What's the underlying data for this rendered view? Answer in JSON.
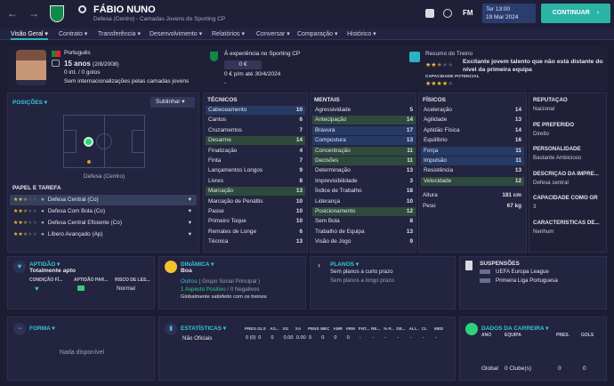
{
  "header": {
    "player_name": "FÁBIO NUNO",
    "subtitle": "Defesa (Centro) - Camadas Jovens do Sporting CP",
    "fm_label": "FM",
    "date_day": "Ter 13:00",
    "date_full": "19 Mar 2024",
    "continue_label": "CONTINUAR"
  },
  "nav": {
    "tabs": [
      "Visão Geral",
      "Contrato",
      "Transferência",
      "Desenvolvimento",
      "Relatórios",
      "Conversar",
      "Comparação",
      "Histórico"
    ]
  },
  "profile": {
    "nationality": "Português",
    "age": "15 anos",
    "birth": "(2/8/2008)",
    "intl": "0 int. / 0 golos",
    "no_youth_caps": "Sem internacionalizações pelas camadas jovens"
  },
  "club": {
    "trial_text": "À experiência no Sporting CP",
    "value": "0 €",
    "wage": "0 € p/m até 30/4/2024",
    "dash": "-"
  },
  "training": {
    "title": "Resumo do Treino",
    "text": "Excitante jovem talento que não está distante do nível da primeira equipa",
    "potential_label": "CAPACIDADE POTENCIAL",
    "current_stars": 2.5,
    "potential_stars": 4
  },
  "positions": {
    "title": "POSIÇÕES",
    "dropdown": "Sublinhar",
    "position_label": "Defesa (Centro)"
  },
  "roles": {
    "title": "PAPEL E TAREFA",
    "items": [
      {
        "name": "Defesa Central (Co)",
        "stars": 2.5
      },
      {
        "name": "Defesa Com Bola (Co)",
        "stars": 2.5
      },
      {
        "name": "Defesa Central Eficiente (Co)",
        "stars": 2.5
      },
      {
        "name": "Líbero Avançado (Ap)",
        "stars": 2.5
      }
    ]
  },
  "technical": {
    "title": "TÉCNICOS",
    "items": [
      {
        "name": "Cabeceamento",
        "value": "10",
        "hl": "blue"
      },
      {
        "name": "Cantos",
        "value": "6",
        "hl": ""
      },
      {
        "name": "Cruzamentos",
        "value": "7",
        "hl": ""
      },
      {
        "name": "Desarme",
        "value": "14",
        "hl": "green"
      },
      {
        "name": "Finalização",
        "value": "4",
        "hl": ""
      },
      {
        "name": "Finta",
        "value": "7",
        "hl": ""
      },
      {
        "name": "Lançamentos Longos",
        "value": "9",
        "hl": ""
      },
      {
        "name": "Livres",
        "value": "8",
        "hl": ""
      },
      {
        "name": "Marcação",
        "value": "13",
        "hl": "green"
      },
      {
        "name": "Marcação de Penáltis",
        "value": "10",
        "hl": ""
      },
      {
        "name": "Passe",
        "value": "10",
        "hl": ""
      },
      {
        "name": "Primeiro Toque",
        "value": "10",
        "hl": ""
      },
      {
        "name": "Remates de Longe",
        "value": "6",
        "hl": ""
      },
      {
        "name": "Técnica",
        "value": "13",
        "hl": ""
      }
    ]
  },
  "mental": {
    "title": "MENTAIS",
    "items": [
      {
        "name": "Agressividade",
        "value": "5",
        "hl": ""
      },
      {
        "name": "Antecipação",
        "value": "14",
        "hl": "green"
      },
      {
        "name": "Bravura",
        "value": "17",
        "hl": "blue"
      },
      {
        "name": "Compostura",
        "value": "13",
        "hl": "blue"
      },
      {
        "name": "Concentração",
        "value": "11",
        "hl": "green"
      },
      {
        "name": "Decisões",
        "value": "11",
        "hl": "green"
      },
      {
        "name": "Determinação",
        "value": "13",
        "hl": ""
      },
      {
        "name": "Imprevisibilidade",
        "value": "3",
        "hl": ""
      },
      {
        "name": "Índice de Trabalho",
        "value": "18",
        "hl": ""
      },
      {
        "name": "Liderança",
        "value": "10",
        "hl": ""
      },
      {
        "name": "Posicionamento",
        "value": "12",
        "hl": "green"
      },
      {
        "name": "Sem Bola",
        "value": "8",
        "hl": ""
      },
      {
        "name": "Trabalho de Equipa",
        "value": "13",
        "hl": ""
      },
      {
        "name": "Visão de Jogo",
        "value": "9",
        "hl": ""
      }
    ]
  },
  "physical": {
    "title": "FÍSICOS",
    "items": [
      {
        "name": "Aceleração",
        "value": "14",
        "hl": ""
      },
      {
        "name": "Agilidade",
        "value": "13",
        "hl": ""
      },
      {
        "name": "Aptidão Física",
        "value": "14",
        "hl": ""
      },
      {
        "name": "Equilíbrio",
        "value": "16",
        "hl": ""
      },
      {
        "name": "Força",
        "value": "11",
        "hl": "blue"
      },
      {
        "name": "Impulsão",
        "value": "11",
        "hl": "blue"
      },
      {
        "name": "Resistência",
        "value": "13",
        "hl": ""
      },
      {
        "name": "Velocidade",
        "value": "12",
        "hl": "green"
      }
    ],
    "height_label": "Altura",
    "height": "181 cm",
    "weight_label": "Peso",
    "weight": "67 kg"
  },
  "info": {
    "items": [
      {
        "label": "REPUTAÇÃO",
        "value": "Nacional"
      },
      {
        "label": "PÉ PREFERIDO",
        "value": "Direito"
      },
      {
        "label": "PERSONALIDADE",
        "value": "Bastante Ambicioso"
      },
      {
        "label": "DESCRIÇÃO DA IMPRE...",
        "value": "Defesa central"
      },
      {
        "label": "CAPACIDADE COMO GR",
        "value": "3"
      },
      {
        "label": "CARACTERÍSTICAS DE...",
        "value": "Nenhum"
      }
    ]
  },
  "fitness": {
    "title": "APTIDÃO",
    "status": "Totalmente apto",
    "col1": "CONDIÇÃO FÍ...",
    "col2": "APTIDÃO PAR...",
    "col3": "RISCO DE LES...",
    "risk": "Normal"
  },
  "dynamics": {
    "title": "DINÂMICA",
    "status": "Boa",
    "group": "Outros",
    "group_detail": "( Grupo Social Principal )",
    "positive": "1 Aspecto Positivo",
    "sep": "/",
    "negative": "0 Negativos",
    "satisfaction": "Globalmente satisfeito com os treinos"
  },
  "plans": {
    "title": "PLANOS",
    "short": "Sem planos a curto prazo",
    "long": "Sem planos a longo prazo"
  },
  "suspensions": {
    "title": "SUSPENSÕES",
    "items": [
      "UEFA Europa League",
      "Primeira Liga Portuguesa"
    ]
  },
  "form": {
    "title": "FORMA",
    "empty": "Nada disponível"
  },
  "stats": {
    "title": "ESTATÍSTICAS",
    "headers": [
      "PRES.",
      "GLS",
      "AS...",
      "XG",
      "XA",
      "PENS",
      "MEC",
      "AMR",
      "VRM",
      "FNT...",
      "RE...",
      "% P...",
      "DE...",
      "ALI...",
      "CL",
      "MED"
    ],
    "row_label": "Não Oficiais",
    "row": [
      "0 (0)",
      "0",
      "0",
      "0.00",
      "0.00",
      "0",
      "0",
      "0",
      "0",
      "-",
      "-",
      "-",
      "-",
      "-",
      "-",
      "-"
    ]
  },
  "career": {
    "title": "DADOS DA CARREIRA",
    "headers": [
      "ANO",
      "EQUIPA",
      "PRES.",
      "GOLS"
    ],
    "row": [
      "Global",
      "0 Clube(s)",
      "0",
      "0"
    ]
  },
  "colors": {
    "accent": "#2bb3a6",
    "cyan": "#35c7d8",
    "green_highlight": "#2e4a3c",
    "blue_highlight": "#263a66",
    "star": "#f2c230"
  }
}
